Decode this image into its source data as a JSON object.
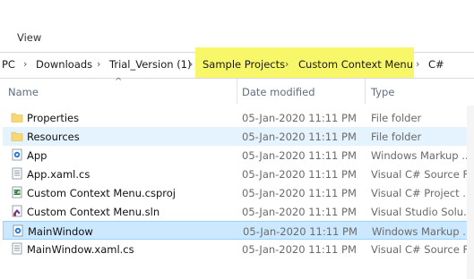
{
  "ribbon": {
    "view_tab": "View"
  },
  "address": {
    "crumbs": [
      "PC",
      "Downloads",
      "Trial_Version (1)",
      "Sample Projects",
      "Custom Context Menu",
      "C#"
    ],
    "separator": "›"
  },
  "columns": {
    "name": "Name",
    "date": "Date modified",
    "type": "Type"
  },
  "files": [
    {
      "name": "Properties",
      "date": "05-Jan-2020 11:11 PM",
      "type": "File folder",
      "icon": "folder-icon"
    },
    {
      "name": "Resources",
      "date": "05-Jan-2020 11:11 PM",
      "type": "File folder",
      "icon": "folder-icon",
      "state": "hover"
    },
    {
      "name": "App",
      "date": "05-Jan-2020 11:11 PM",
      "type": "Windows Markup ...",
      "icon": "xaml-file-icon"
    },
    {
      "name": "App.xaml.cs",
      "date": "05-Jan-2020 11:11 PM",
      "type": "Visual C# Source F...",
      "icon": "cs-file-icon"
    },
    {
      "name": "Custom Context Menu.csproj",
      "date": "05-Jan-2020 11:11 PM",
      "type": "Visual C# Project ...",
      "icon": "csproj-file-icon"
    },
    {
      "name": "Custom Context Menu.sln",
      "date": "05-Jan-2020 11:11 PM",
      "type": "Visual Studio Solu...",
      "icon": "sln-file-icon"
    },
    {
      "name": "MainWindow",
      "date": "05-Jan-2020 11:11 PM",
      "type": "Windows Markup ...",
      "icon": "xaml-file-icon",
      "state": "selected"
    },
    {
      "name": "MainWindow.xaml.cs",
      "date": "05-Jan-2020 11:11 PM",
      "type": "Visual C# Source F...",
      "icon": "cs-file-icon"
    }
  ],
  "colors": {
    "highlight": "#f7f769",
    "hover": "#e5f3ff",
    "selected": "#cce8ff",
    "folder": "#f8d775",
    "accent": "#1e73d8"
  }
}
